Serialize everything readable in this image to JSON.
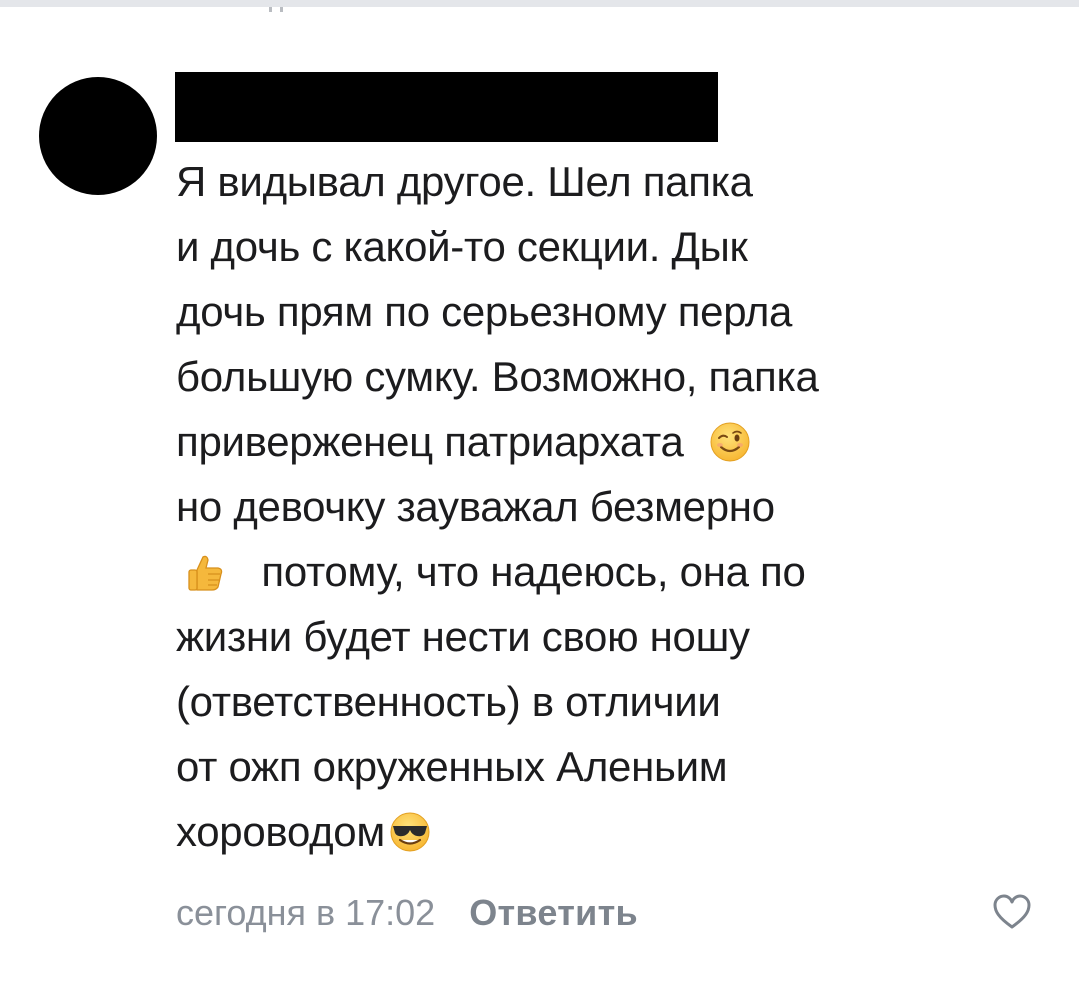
{
  "comment": {
    "author_name": "",
    "lines": {
      "l1": "Я видывал другое. Шел папка",
      "l2": "и дочь с какой-то секции. Дык",
      "l3": "дочь прям по серьезному перла",
      "l4": "большую сумку. Возможно, папка",
      "l5": "приверженец патриархата",
      "l6": "но девочку зауважал безмерно",
      "l7": "потому, что надеюсь, она по",
      "l8": "жизни будет нести свою ношу",
      "l9": "(ответственность) в отличии",
      "l10": "от ожп окруженных Аленьим",
      "l11": "хороводом"
    },
    "emojis": [
      "winking-face",
      "thumbs-up",
      "smiling-face-with-sunglasses"
    ],
    "timestamp": "сегодня в 17:02",
    "reply_label": "Ответить",
    "like_icon": "heart-outline-icon"
  },
  "colors": {
    "text": "#1c1c1e",
    "meta": "#8a9099",
    "redaction": "#000000",
    "divider": "#e4e6ea"
  }
}
